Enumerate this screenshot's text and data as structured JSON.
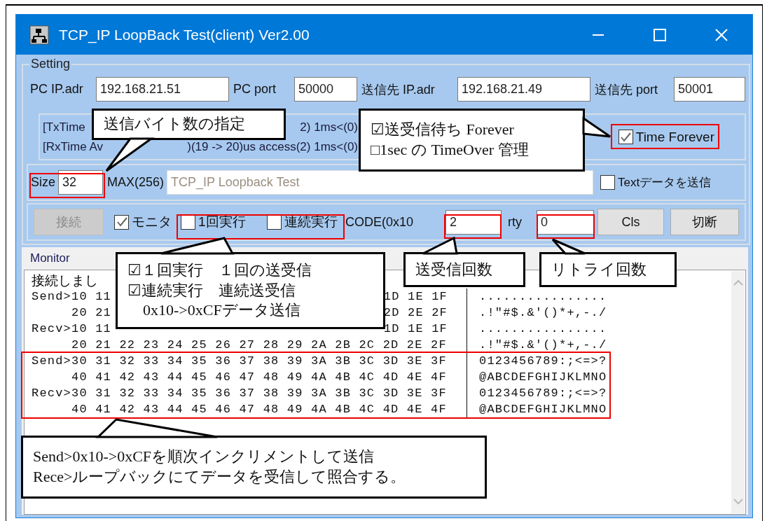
{
  "window": {
    "title": "TCP_IP LoopBack Test(client) Ver2.00"
  },
  "setting": {
    "label": "Setting",
    "fields": [
      {
        "label": "PC IP.adr",
        "value": "192.168.21.51"
      },
      {
        "label": "PC port",
        "value": "50000"
      },
      {
        "label": "送信先 IP.adr",
        "value": "192.168.21.49"
      },
      {
        "label": "送信先 port",
        "value": "50001"
      }
    ],
    "status_lines": [
      {
        "parts": [
          "[TxTime",
          "2) 1ms<(0)"
        ]
      },
      {
        "parts": [
          "[RxTime Av",
          ")(19 -> 20)us access(2) 1ms<(0)"
        ]
      }
    ],
    "time_forever": {
      "label": "Time Forever",
      "checked": true
    },
    "size": {
      "label": "Size",
      "value": "32"
    },
    "max_label": "MAX(256)",
    "text_field": {
      "value": "TCP_IP Loopback Test",
      "disabled": true
    },
    "text_send": {
      "label": "Textデータを送信",
      "checked": false
    },
    "controls": [
      {
        "kind": "button",
        "label": "接続",
        "disabled": true
      },
      {
        "kind": "checkbox",
        "label": "モニタ",
        "checked": true
      },
      {
        "kind": "checkbox",
        "label": "1回実行",
        "checked": false
      },
      {
        "kind": "checkbox",
        "label": "連続実行",
        "checked": false
      },
      {
        "kind": "label",
        "text": "CODE(0x10"
      },
      {
        "kind": "field",
        "value": "2"
      },
      {
        "kind": "label",
        "text": "rty"
      },
      {
        "kind": "field",
        "value": "0"
      },
      {
        "kind": "button",
        "label": "Cls",
        "disabled": false
      },
      {
        "kind": "button",
        "label": "切断",
        "disabled": false
      }
    ]
  },
  "monitor": {
    "label": "Monitor",
    "lines": [
      {
        "kind": "message",
        "text": "接続しまし"
      },
      {
        "kind": "data",
        "prefix": "Send>",
        "hex": "10 11",
        "hex_tail": "1D 1E 1F",
        "ascii": "................"
      },
      {
        "kind": "data",
        "hex": "20 21",
        "hex_tail": "2D 2E 2F",
        "ascii": ".!\"#$.&'()*+,-./"
      },
      {
        "kind": "data",
        "prefix": "Recv>",
        "hex": "10 11",
        "hex_tail": "1D 1E 1F",
        "ascii": "................"
      },
      {
        "kind": "data",
        "hex": "20 21 22 23 24 25 26 27 28 29 2A 2B 2C 2D 2E 2F",
        "ascii": ".!\"#$.&'()*+,-./"
      },
      {
        "kind": "data",
        "prefix": "Send>",
        "hex": "30 31 32 33 34 35 36 37 38 39 3A 3B 3C 3D 3E 3F",
        "ascii": "0123456789:;<=>?"
      },
      {
        "kind": "data",
        "hex": "40 41 42 43 44 45 46 47 48 49 4A 4B 4C 4D 4E 4F",
        "ascii": "@ABCDEFGHIJKLMNO"
      },
      {
        "kind": "data",
        "prefix": "Recv>",
        "hex": "30 31 32 33 34 35 36 37 38 39 3A 3B 3C 3D 3E 3F",
        "ascii": "0123456789:;<=>?"
      },
      {
        "kind": "data",
        "hex": "40 41 42 43 44 45 46 47 48 49 4A 4B 4C 4D 4E 4F",
        "ascii": "@ABCDEFGHIJKLMNO"
      }
    ]
  },
  "callouts": [
    {
      "lines": [
        "送信バイト数の指定"
      ]
    },
    {
      "lines": [
        "☑送受信待ち Forever",
        "□1sec の TimeOver 管理"
      ]
    },
    {
      "lines": [
        "☑１回実行　１回の送受信",
        "☑連続実行　連続送受信",
        "　0x10->0xCFデータ送信"
      ]
    },
    {
      "lines": [
        "送受信回数"
      ]
    },
    {
      "lines": [
        "リトライ回数"
      ]
    },
    {
      "lines": [
        "Send>0x10->0xCFを順次インクリメントして送信",
        "Rece>ループバックにてデータを受信して照合する。"
      ]
    }
  ]
}
